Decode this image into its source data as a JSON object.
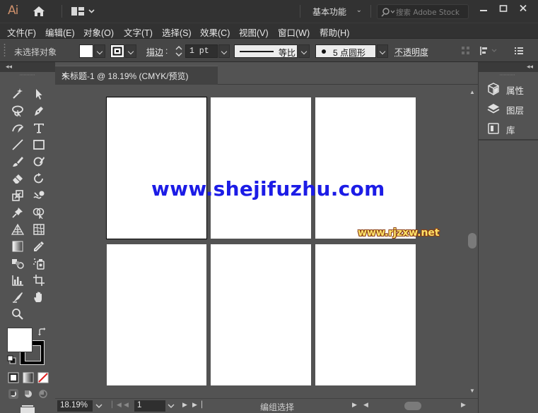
{
  "app": {
    "logo": "Ai",
    "workspace": "基本功能",
    "search_placeholder": "搜索 Adobe Stock"
  },
  "menu": [
    "文件(F)",
    "编辑(E)",
    "对象(O)",
    "文字(T)",
    "选择(S)",
    "效果(C)",
    "视图(V)",
    "窗口(W)",
    "帮助(H)"
  ],
  "control_bar": {
    "selection_status": "未选择对象",
    "stroke_label": "描边",
    "stroke_value": "1 pt",
    "stroke_style_label": "等比",
    "brush_label": "5 点圆形",
    "opacity_label": "不透明度"
  },
  "document": {
    "tab_title": "未标题-1 @ 18.19% (CMYK/预览)",
    "close": "×"
  },
  "watermarks": {
    "primary": "www.shejifuzhu.com",
    "secondary": "www.rjzxw.net"
  },
  "status_bar": {
    "zoom": "18.19%",
    "artboard": "1",
    "status": "编组选择"
  },
  "right_panel": {
    "items": [
      {
        "label": "属性",
        "icon": "properties-icon"
      },
      {
        "label": "图层",
        "icon": "layers-icon"
      },
      {
        "label": "库",
        "icon": "libraries-icon"
      }
    ]
  },
  "colors": {
    "ui_dark": "#323232",
    "ui_panel": "#535353",
    "logo": "#cc8f6b",
    "watermark_blue": "#1c1ce6",
    "watermark_gold": "#ffe36a"
  }
}
